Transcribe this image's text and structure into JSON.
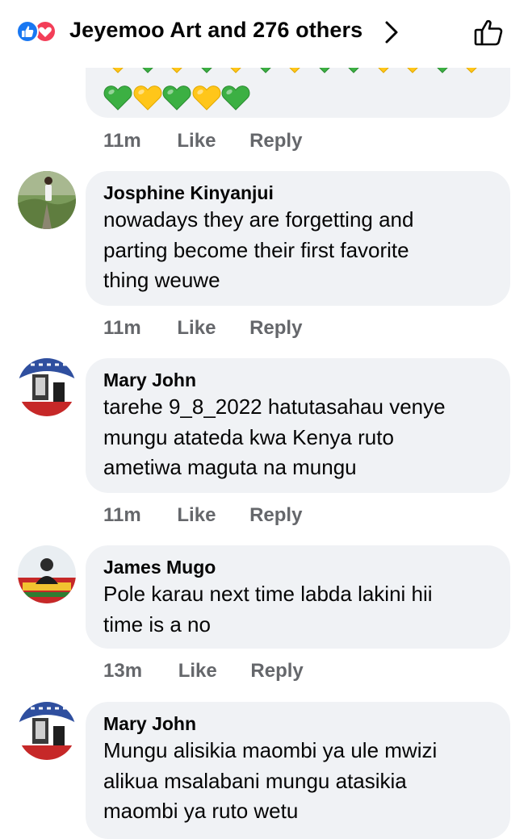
{
  "header": {
    "title": "Jeyemoo Art and 276 others",
    "reactions": [
      "like-icon",
      "love-icon"
    ],
    "colors": {
      "like": "#1877f2",
      "love": "#f33e58"
    }
  },
  "first_comment": {
    "hearts_row1": [
      "yellow",
      "green",
      "yellow",
      "green",
      "yellow",
      "green",
      "yellow",
      "green",
      "green",
      "yellow",
      "yellow",
      "green",
      "yellow"
    ],
    "hearts_row2": [
      "green",
      "yellow",
      "green",
      "yellow",
      "green"
    ],
    "time": "11m",
    "like": "Like",
    "reply": "Reply"
  },
  "comments": [
    {
      "name": "Josphine Kinyanjui",
      "lines": [
        "nowadays they are forgetting and",
        "parting become their first favorite",
        "thing weuwe"
      ],
      "time": "11m",
      "like": "Like",
      "reply": "Reply"
    },
    {
      "name": "Mary John",
      "lines": [
        "tarehe 9_8_2022 hatutasahau venye",
        "mungu atateda kwa Kenya ruto",
        "ametiwa maguta na mungu"
      ],
      "time": "11m",
      "like": "Like",
      "reply": "Reply"
    },
    {
      "name": "James Mugo",
      "lines": [
        "Pole karau next time labda lakini hii",
        "time is a no"
      ],
      "time": "13m",
      "like": "Like",
      "reply": "Reply"
    },
    {
      "name": "Mary John",
      "lines": [
        "Mungu alisikia maombi ya ule mwizi",
        "alikua msalabani mungu atasikia",
        "maombi ya ruto wetu"
      ]
    }
  ],
  "colors": {
    "heart_green": "#3cb043",
    "heart_yellow": "#ffc61a",
    "meta_gray": "#65676b",
    "bubble": "#f0f2f5"
  }
}
